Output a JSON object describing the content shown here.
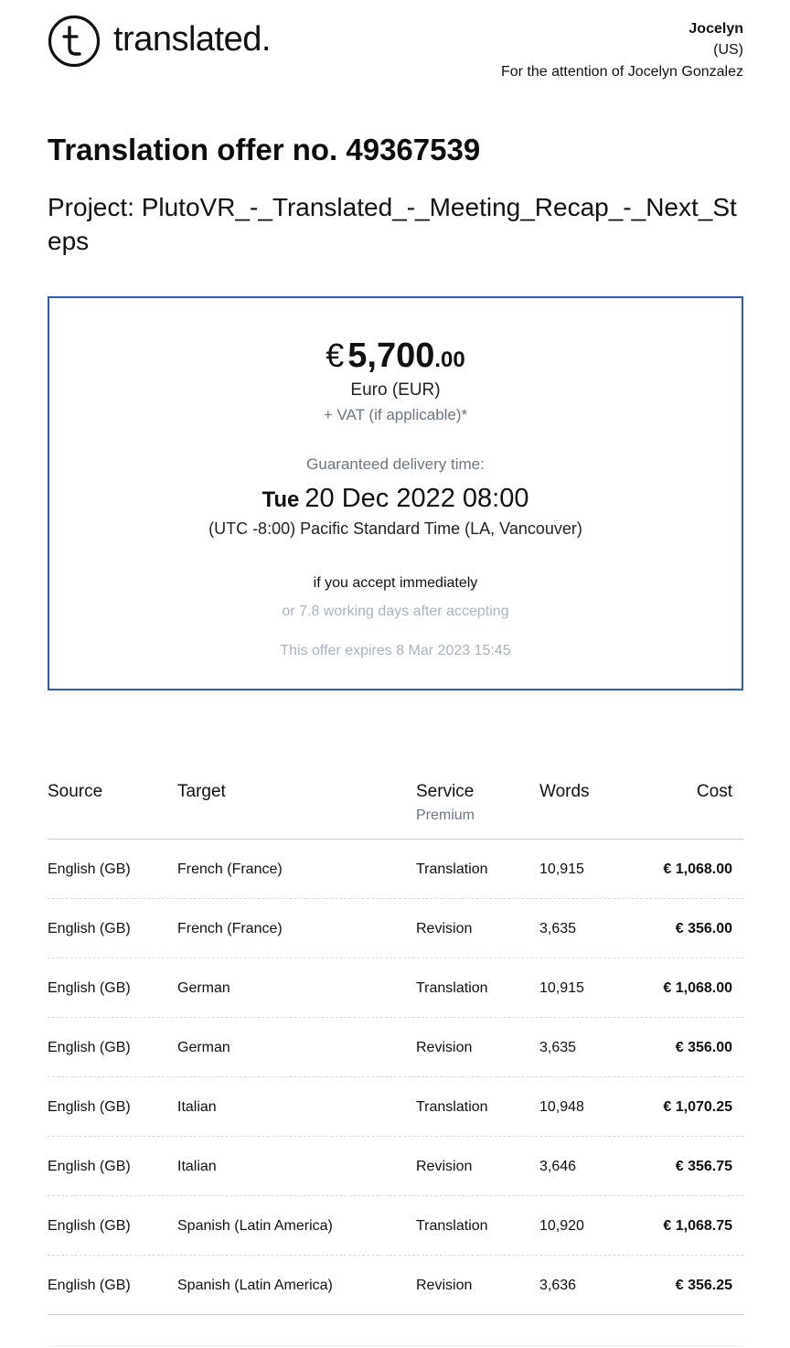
{
  "brand": {
    "logo_text": "translated.",
    "logo_icon": "translated-logo-icon"
  },
  "recipient": {
    "name": "Jocelyn",
    "country": "(US)",
    "attention": "For the attention of Jocelyn Gonzalez"
  },
  "offer": {
    "title": "Translation offer no. 49367539",
    "project": "Project: PlutoVR_-_Translated_-_Meeting_Recap_-_Next_Steps"
  },
  "summary": {
    "currency_symbol": "€",
    "price_integer": "5,700",
    "price_decimals": ".00",
    "currency_name": "Euro (EUR)",
    "vat_note": "+ VAT (if applicable)*",
    "delivery_label": "Guaranteed delivery time:",
    "delivery_weekday": "Tue",
    "delivery_date": "20 Dec 2022 08:00",
    "timezone": "(UTC -8:00) Pacific Standard Time (LA, Vancouver)",
    "accept_now": "if you accept immediately",
    "accept_later": "or 7.8 working days after accepting",
    "expires": "This offer expires 8 Mar 2023 15:45",
    "border_color": "#2a5db0"
  },
  "table": {
    "headers": {
      "source": "Source",
      "target": "Target",
      "service": "Service",
      "service_tier": "Premium",
      "words": "Words",
      "cost": "Cost"
    },
    "rows": [
      {
        "source": "English (GB)",
        "target": "French (France)",
        "service": "Translation",
        "words": "10,915",
        "cost": "€ 1,068.00"
      },
      {
        "source": "English (GB)",
        "target": "French (France)",
        "service": "Revision",
        "words": "3,635",
        "cost": "€ 356.00"
      },
      {
        "source": "English (GB)",
        "target": "German",
        "service": "Translation",
        "words": "10,915",
        "cost": "€ 1,068.00"
      },
      {
        "source": "English (GB)",
        "target": "German",
        "service": "Revision",
        "words": "3,635",
        "cost": "€ 356.00"
      },
      {
        "source": "English (GB)",
        "target": "Italian",
        "service": "Translation",
        "words": "10,948",
        "cost": "€ 1,070.25"
      },
      {
        "source": "English (GB)",
        "target": "Italian",
        "service": "Revision",
        "words": "3,646",
        "cost": "€ 356.75"
      },
      {
        "source": "English (GB)",
        "target": "Spanish (Latin America)",
        "service": "Translation",
        "words": "10,920",
        "cost": "€ 1,068.75"
      },
      {
        "source": "English (GB)",
        "target": "Spanish (Latin America)",
        "service": "Revision",
        "words": "3,636",
        "cost": "€ 356.25"
      }
    ]
  }
}
